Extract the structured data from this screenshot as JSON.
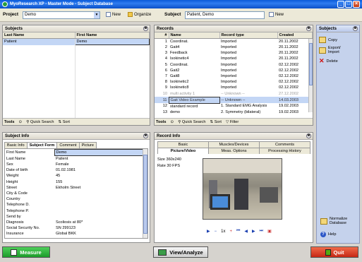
{
  "window": {
    "title": "MyoResearch XP - Master Mode - Subject Database"
  },
  "toolbar": {
    "project_label": "Project",
    "project_value": "Demo",
    "new_label": "New",
    "organize_label": "Organize",
    "subject_label": "Subject",
    "subject_value": "Patient, Demo",
    "subject_new_label": "New"
  },
  "subjects": {
    "title": "Subjects",
    "columns": [
      "Last Name",
      "First Name"
    ],
    "rows": [
      [
        "Patient",
        "Demo"
      ]
    ],
    "footer": {
      "tools": "Tools",
      "quick_search": "Quick Search",
      "sort": "Sort"
    }
  },
  "records": {
    "title": "Records",
    "columns": [
      "#",
      "Name",
      "Record type",
      "Created"
    ],
    "rows": [
      [
        "1",
        "Coordinat.",
        "Imported",
        "20.11.2002"
      ],
      [
        "2",
        "Gait4",
        "Imported",
        "20.11.2002"
      ],
      [
        "3",
        "Feedback",
        "Imported",
        "20.11.2002"
      ],
      [
        "4",
        "Isokinetic4",
        "Imported",
        "20.11.2002"
      ],
      [
        "5",
        "Coordinat.",
        "Imported",
        "02.12.2002"
      ],
      [
        "6",
        "Gait2",
        "Imported",
        "02.12.2002"
      ],
      [
        "7",
        "Gait8",
        "Imported",
        "02.12.2002"
      ],
      [
        "8",
        "Isokinetic2",
        "Imported",
        "02.12.2002"
      ],
      [
        "9",
        "Isokinetic8",
        "Imported",
        "02.12.2002"
      ],
      [
        "10",
        "multi activity 1",
        "-- Unknown --",
        "27.12.2002"
      ],
      [
        "11",
        "Gait Video Example",
        "-- Unknown --",
        "14.03.2003"
      ],
      [
        "12",
        "standard record",
        "1. Standard EMG Analysis",
        "19.02.2003"
      ],
      [
        "13",
        "demo",
        "2. Symmetry (bilateral)",
        "19.02.2003"
      ]
    ],
    "footer": {
      "tools": "Tools",
      "quick_search": "Quick Search",
      "sort": "Sort",
      "filter": "Filter"
    }
  },
  "sidebar": {
    "title": "Subjects",
    "copy": "Copy",
    "export_import": "Export/ Import",
    "delete": "Delete",
    "normalize": "Normalize Database",
    "help": "Help"
  },
  "subject_info": {
    "title": "Subject Info",
    "tabs": [
      "Basic Info",
      "Subject Form",
      "Comment",
      "Picture"
    ],
    "rows": [
      [
        "First Name",
        "Demo"
      ],
      [
        "Last Name",
        "Patient"
      ],
      [
        "Sex",
        "Female"
      ],
      [
        "Date of birth",
        "01.02.1981"
      ],
      [
        "Weight",
        "45"
      ],
      [
        "Height",
        "155"
      ],
      [
        "Street",
        "Ekholm Street"
      ],
      [
        "City & Code",
        ""
      ],
      [
        "Country",
        ""
      ],
      [
        "Telephone D.",
        ""
      ],
      [
        "Telephone P.",
        ""
      ],
      [
        "Send by",
        ""
      ],
      [
        "Diagnosis",
        "Scoliosis at 80*"
      ],
      [
        "Social Security No.",
        "SN 299123"
      ],
      [
        "Insurance",
        "Global BKK"
      ]
    ]
  },
  "record_info": {
    "title": "Record Info",
    "tabs_row1": [
      "Basic",
      "Muscles/Devices",
      "Comments"
    ],
    "tabs_row2": [
      "Picture/Video",
      "Meas. Options",
      "Processing History"
    ],
    "size_label": "Size",
    "size_value": "360x240",
    "rate_label": "Rate",
    "rate_value": "30 FPS",
    "speed": "1x"
  },
  "bottom": {
    "measure": "Measure",
    "view_analyze": "View/Analyze",
    "quit": "Quit"
  }
}
